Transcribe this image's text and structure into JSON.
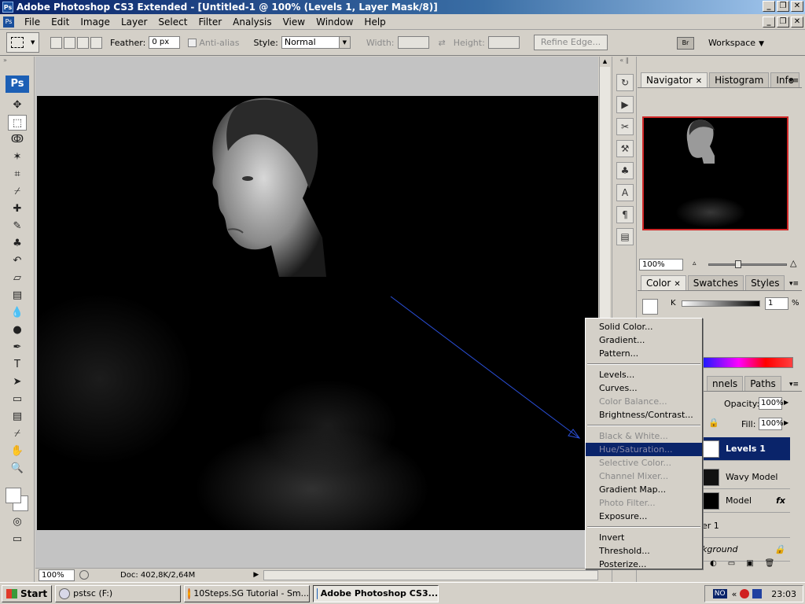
{
  "window": {
    "title": "Adobe Photoshop CS3 Extended - [Untitled-1 @ 100% (Levels 1, Layer Mask/8)]",
    "app_icon": "Ps",
    "buttons": [
      "_",
      "❐",
      "✕"
    ]
  },
  "menubar": {
    "items": [
      "File",
      "Edit",
      "Image",
      "Layer",
      "Select",
      "Filter",
      "Analysis",
      "View",
      "Window",
      "Help"
    ]
  },
  "options": {
    "feather_label": "Feather:",
    "feather_value": "0 px",
    "antialias_label": "Anti-alias",
    "style_label": "Style:",
    "style_value": "Normal",
    "width_label": "Width:",
    "height_label": "Height:",
    "refine_edge": "Refine Edge...",
    "bridge_icon": "Br",
    "workspace_label": "Workspace"
  },
  "toolbox": {
    "logo": "Ps",
    "tools": [
      {
        "name": "move-tool-icon",
        "glyph": "✥"
      },
      {
        "name": "marquee-tool-icon",
        "glyph": "⬚"
      },
      {
        "name": "lasso-tool-icon",
        "glyph": "ↂ"
      },
      {
        "name": "magic-wand-tool-icon",
        "glyph": "✶"
      },
      {
        "name": "crop-tool-icon",
        "glyph": "⌗"
      },
      {
        "name": "eyedropper-tool-icon",
        "glyph": "⌿"
      },
      {
        "name": "healing-brush-tool-icon",
        "glyph": "✚"
      },
      {
        "name": "brush-tool-icon",
        "glyph": "✎"
      },
      {
        "name": "clone-stamp-tool-icon",
        "glyph": "♣"
      },
      {
        "name": "history-brush-tool-icon",
        "glyph": "↶"
      },
      {
        "name": "eraser-tool-icon",
        "glyph": "▱"
      },
      {
        "name": "gradient-tool-icon",
        "glyph": "▤"
      },
      {
        "name": "blur-tool-icon",
        "glyph": "💧"
      },
      {
        "name": "dodge-tool-icon",
        "glyph": "●"
      },
      {
        "name": "pen-tool-icon",
        "glyph": "✒"
      },
      {
        "name": "type-tool-icon",
        "glyph": "T"
      },
      {
        "name": "path-selection-tool-icon",
        "glyph": "➤"
      },
      {
        "name": "shape-tool-icon",
        "glyph": "▭"
      },
      {
        "name": "notes-tool-icon",
        "glyph": "▤"
      },
      {
        "name": "eyedropper2-tool-icon",
        "glyph": "⌿"
      },
      {
        "name": "hand-tool-icon",
        "glyph": "✋"
      },
      {
        "name": "zoom-tool-icon",
        "glyph": "🔍"
      }
    ]
  },
  "status": {
    "zoom": "100%",
    "doc_info": "Doc: 402,8K/2,64M"
  },
  "navigator": {
    "tabs": [
      "Navigator",
      "Histogram",
      "Info"
    ],
    "zoom": "100%"
  },
  "color": {
    "tabs": [
      "Color",
      "Swatches",
      "Styles"
    ],
    "k_label": "K",
    "k_value": "1",
    "pct": "%"
  },
  "layers": {
    "tabs_visible": [
      "nnels",
      "Paths"
    ],
    "opacity_label": "Opacity:",
    "opacity_value": "100%",
    "fill_label": "Fill:",
    "fill_value": "100%",
    "items": [
      {
        "name": "Levels 1",
        "selected": true
      },
      {
        "name": "Wavy Model",
        "selected": false
      },
      {
        "name": "Model",
        "selected": false,
        "fx": "fx"
      },
      {
        "name": "er 1",
        "selected": false
      },
      {
        "name": "kground",
        "selected": false
      }
    ]
  },
  "context_menu": {
    "groups": [
      [
        {
          "label": "Solid Color...",
          "enabled": true
        },
        {
          "label": "Gradient...",
          "enabled": true
        },
        {
          "label": "Pattern...",
          "enabled": true
        }
      ],
      [
        {
          "label": "Levels...",
          "enabled": true
        },
        {
          "label": "Curves...",
          "enabled": true
        },
        {
          "label": "Color Balance...",
          "enabled": false
        },
        {
          "label": "Brightness/Contrast...",
          "enabled": true
        }
      ],
      [
        {
          "label": "Black & White...",
          "enabled": false
        },
        {
          "label": "Hue/Saturation...",
          "enabled": false,
          "highlighted": true
        },
        {
          "label": "Selective Color...",
          "enabled": false
        },
        {
          "label": "Channel Mixer...",
          "enabled": false
        },
        {
          "label": "Gradient Map...",
          "enabled": true
        },
        {
          "label": "Photo Filter...",
          "enabled": false
        },
        {
          "label": "Exposure...",
          "enabled": true
        }
      ],
      [
        {
          "label": "Invert",
          "enabled": true
        },
        {
          "label": "Threshold...",
          "enabled": true
        },
        {
          "label": "Posterize...",
          "enabled": true
        }
      ]
    ]
  },
  "taskbar": {
    "start": "Start",
    "tasks": [
      {
        "label": "pstsc (F:)",
        "active": false
      },
      {
        "label": "10Steps.SG Tutorial - Sm...",
        "active": false
      },
      {
        "label": "Adobe Photoshop CS3...",
        "active": true
      }
    ],
    "ime": "NO",
    "clock": "23:03"
  }
}
